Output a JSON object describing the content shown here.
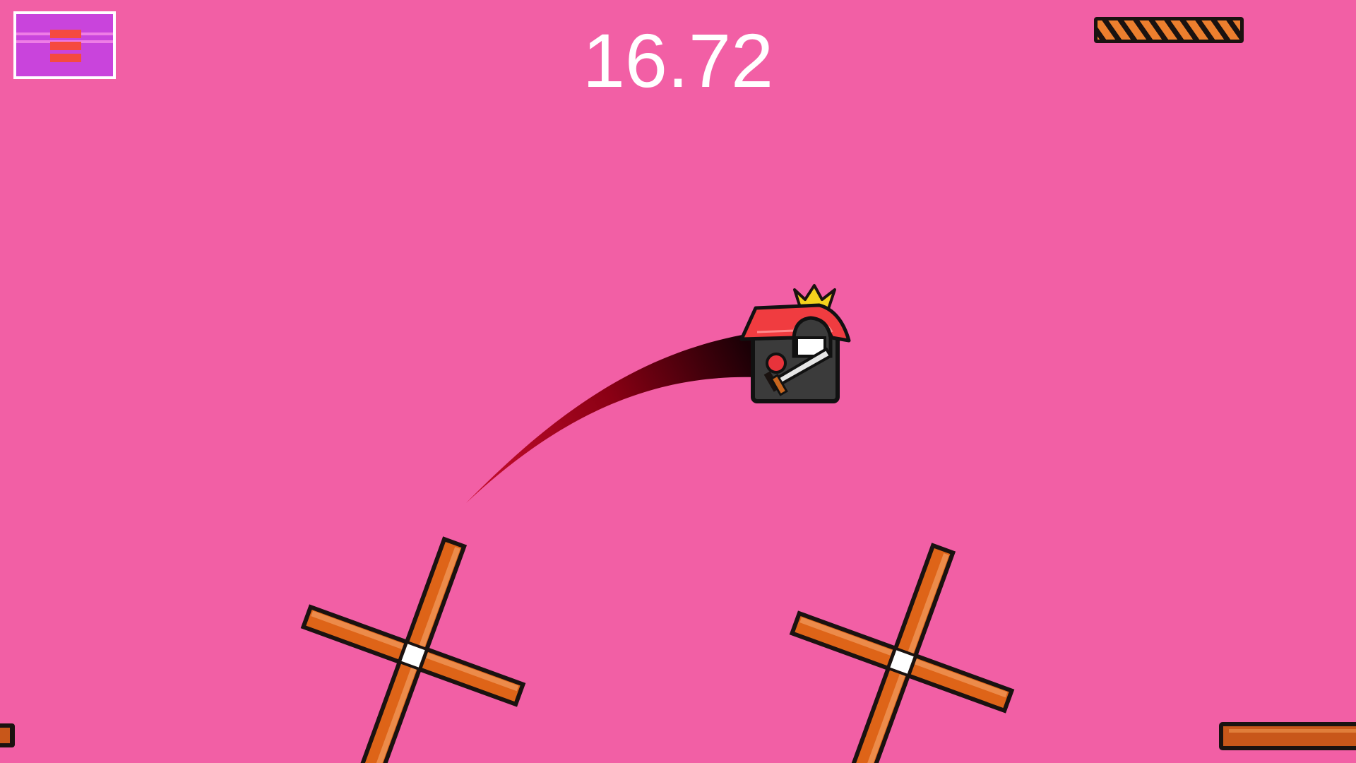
{
  "hud": {
    "timer": "16.72",
    "menu_icon": "hamburger-menu-icon"
  },
  "colors": {
    "background": "#f25fa5",
    "menu_button": "#c944dc",
    "menu_bars": "#f54a3f",
    "platform_orange": "#de6418",
    "trail": "#c0001a",
    "player_roof": "#f03c40",
    "player_body": "#3b3b3b",
    "crown": "#f5d21d"
  },
  "game": {
    "player": "samurai-house-player",
    "hazards": [
      "spinning-cross-blade",
      "spinning-cross-blade"
    ],
    "platforms": [
      "striped-floating-platform",
      "wooden-platform",
      "wooden-platform"
    ]
  }
}
